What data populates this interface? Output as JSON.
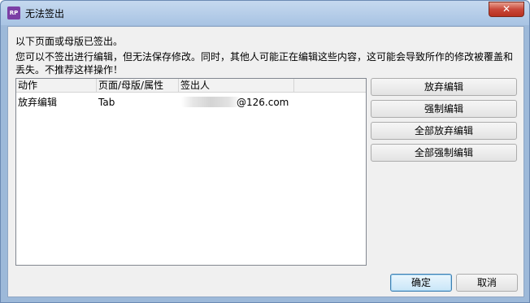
{
  "window": {
    "icon_text": "RP",
    "title": "无法签出",
    "close_glyph": "✕"
  },
  "message": {
    "line1": "以下页面或母版已签出。",
    "line2": "您可以不签出进行编辑，但无法保存修改。同时，其他人可能正在编辑这些内容，这可能会导致所作的修改被覆盖和丢失。不推荐这样操作！"
  },
  "table": {
    "columns": [
      "动作",
      "页面/母版/属性",
      "签出人"
    ],
    "rows": [
      {
        "action": "放弃编辑",
        "page": "Tab",
        "owner": "@126.com"
      }
    ]
  },
  "side_buttons": [
    "放弃编辑",
    "强制编辑",
    "全部放弃编辑",
    "全部强制编辑"
  ],
  "footer": {
    "ok_label": "确定",
    "cancel_label": "取消"
  }
}
